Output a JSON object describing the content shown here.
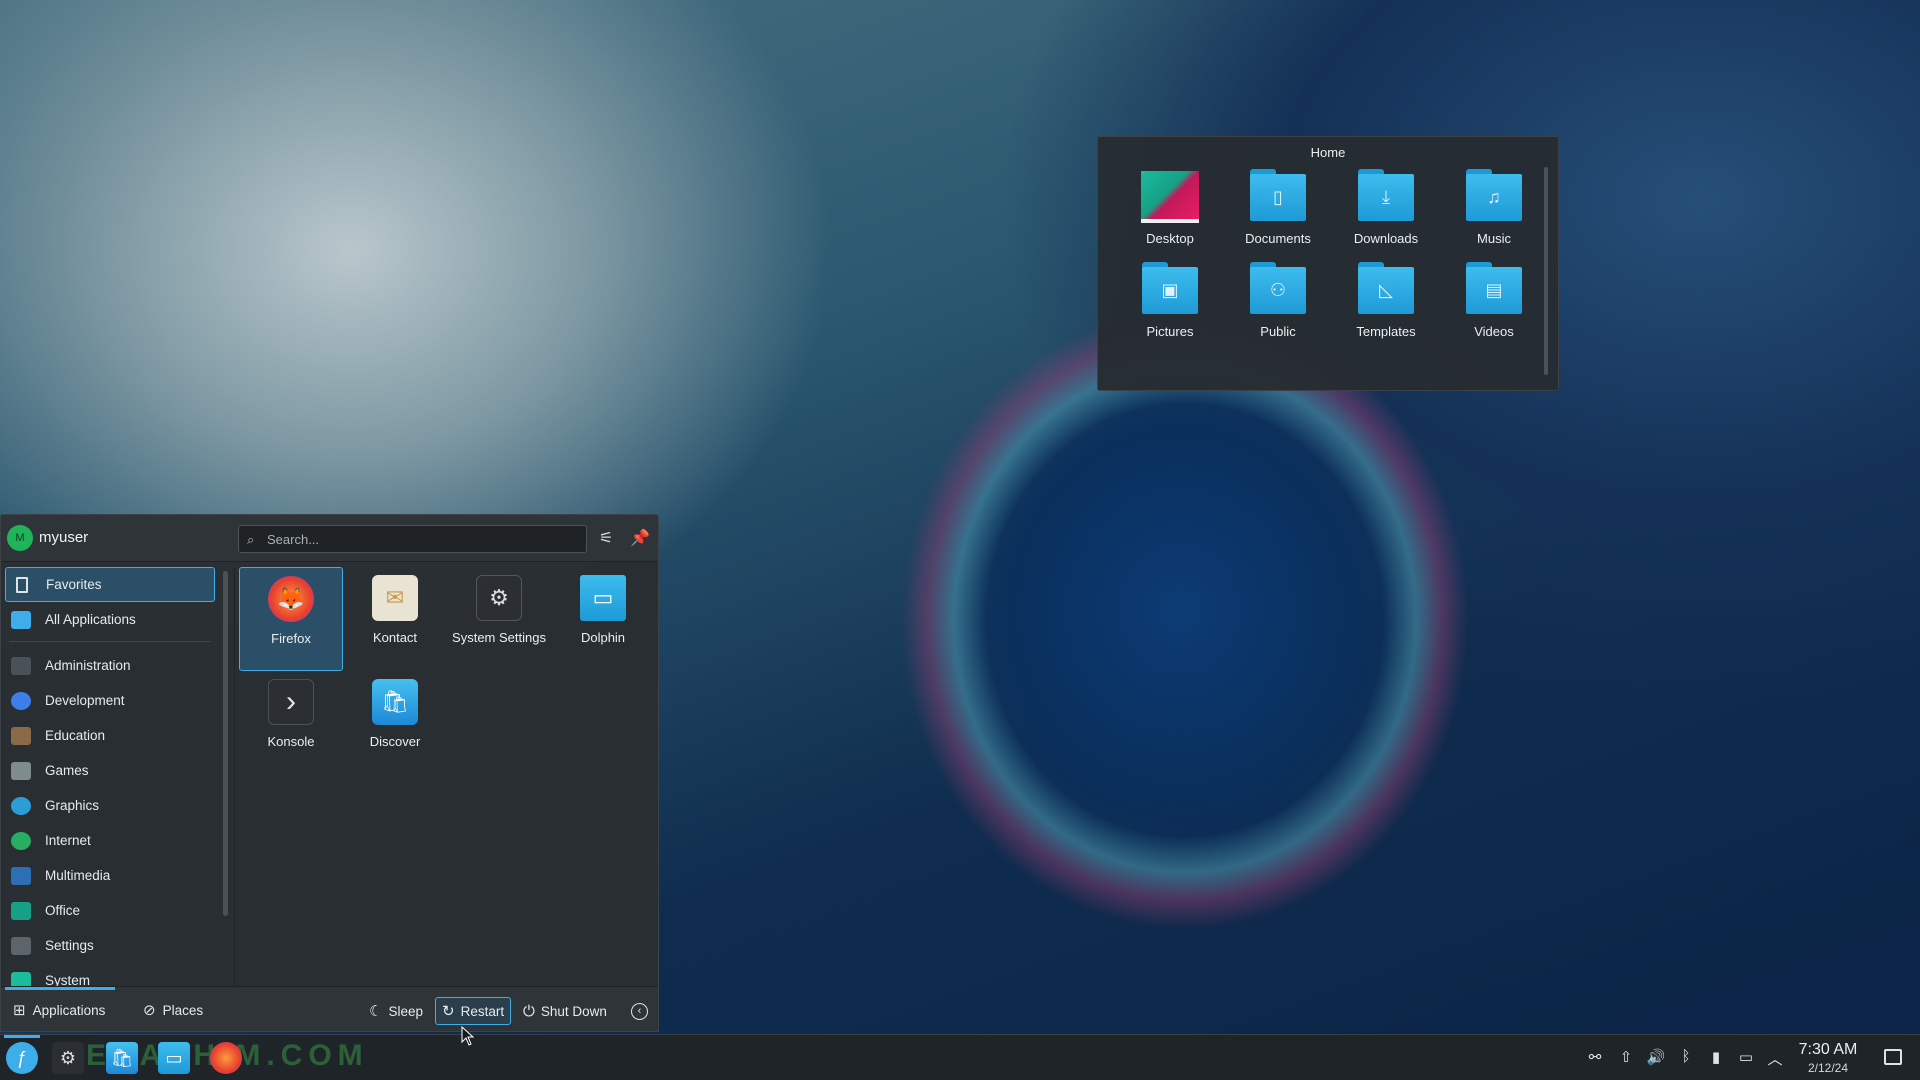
{
  "home_popup": {
    "title": "Home",
    "folders": [
      {
        "label": "Desktop",
        "icon": "desktop-folder-icon"
      },
      {
        "label": "Documents",
        "icon": "documents-folder-icon",
        "glyph": "▯"
      },
      {
        "label": "Downloads",
        "icon": "downloads-folder-icon",
        "glyph": "⤓"
      },
      {
        "label": "Music",
        "icon": "music-folder-icon",
        "glyph": "♫"
      },
      {
        "label": "Pictures",
        "icon": "pictures-folder-icon",
        "glyph": "▣"
      },
      {
        "label": "Public",
        "icon": "public-folder-icon",
        "glyph": "⚇"
      },
      {
        "label": "Templates",
        "icon": "templates-folder-icon",
        "glyph": "◺"
      },
      {
        "label": "Videos",
        "icon": "videos-folder-icon",
        "glyph": "▤"
      }
    ]
  },
  "launcher": {
    "user": {
      "initial": "M",
      "name": "myuser"
    },
    "search": {
      "placeholder": "Search..."
    },
    "categories": [
      {
        "label": "Favorites",
        "icon": "bookmark-icon",
        "color": "#2b4f66"
      },
      {
        "label": "All Applications",
        "icon": "all-apps-icon",
        "color": "#3daee9"
      },
      {
        "label": "Administration",
        "icon": "administration-icon",
        "color": "#4a5157"
      },
      {
        "label": "Development",
        "icon": "development-icon",
        "color": "#3d7ee9"
      },
      {
        "label": "Education",
        "icon": "education-icon",
        "color": "#8a6a48"
      },
      {
        "label": "Games",
        "icon": "games-icon",
        "color": "#7f8c8d"
      },
      {
        "label": "Graphics",
        "icon": "graphics-icon",
        "color": "#2a9fd6"
      },
      {
        "label": "Internet",
        "icon": "internet-icon",
        "color": "#27ae60"
      },
      {
        "label": "Multimedia",
        "icon": "multimedia-icon",
        "color": "#2c6fb5"
      },
      {
        "label": "Office",
        "icon": "office-icon",
        "color": "#16a085"
      },
      {
        "label": "Settings",
        "icon": "settings-icon",
        "color": "#5d646a"
      },
      {
        "label": "System",
        "icon": "system-icon",
        "color": "#1abc9c"
      }
    ],
    "apps": [
      {
        "label": "Firefox",
        "icon": "firefox-icon",
        "glyph": "🦊"
      },
      {
        "label": "Kontact",
        "icon": "kontact-icon",
        "glyph": "✉"
      },
      {
        "label": "System Settings",
        "icon": "system-settings-icon",
        "glyph": "⚙"
      },
      {
        "label": "Dolphin",
        "icon": "dolphin-icon",
        "glyph": "▭"
      },
      {
        "label": "Konsole",
        "icon": "konsole-icon",
        "glyph": "›"
      },
      {
        "label": "Discover",
        "icon": "discover-icon",
        "glyph": "🛍"
      }
    ],
    "footer": {
      "applications_label": "Applications",
      "places_label": "Places",
      "sleep_label": "Sleep",
      "restart_label": "Restart",
      "shutdown_label": "Shut Down"
    }
  },
  "taskbar": {
    "watermark": "SERAPHIM.COM",
    "time": "7:30 AM",
    "date": "2/12/24"
  },
  "colors": {
    "accent": "#3daee9",
    "panel": "#2a2e32"
  }
}
